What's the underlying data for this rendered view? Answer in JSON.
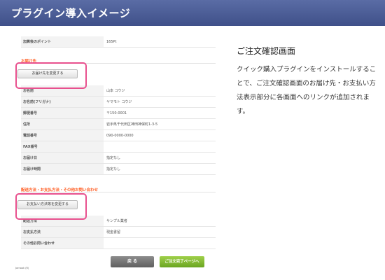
{
  "header": {
    "title": "プラグイン導入イメージ"
  },
  "screenshot": {
    "top_row": {
      "label": "加算後のポイント",
      "value": "165Pt"
    },
    "section_delivery": {
      "title": "お届け先",
      "button": "お届け先を変更する",
      "rows": [
        {
          "label": "お名前",
          "value": "山本 コウジ"
        },
        {
          "label": "お名前(フリガナ)",
          "value": "ヤマモト コウジ"
        },
        {
          "label": "郵便番号",
          "value": "〒150-0001"
        },
        {
          "label": "住所",
          "value": "岩手県千代田区神田神保町1-3-5"
        },
        {
          "label": "電話番号",
          "value": "090-0000-0000"
        },
        {
          "label": "FAX番号",
          "value": ""
        },
        {
          "label": "お届け日",
          "value": "指定なし"
        },
        {
          "label": "お届け時間",
          "value": "指定なし"
        }
      ]
    },
    "section_payment": {
      "title": "配送方法・お支払方法・その他お問い合わせ",
      "button": "お支払い方法等を変更する",
      "rows": [
        {
          "label": "配送方法",
          "value": "サンプル業者"
        },
        {
          "label": "お支払方法",
          "value": "現金書留"
        },
        {
          "label": "その他お問い合わせ",
          "value": ""
        }
      ]
    },
    "buttons": {
      "back": "戻 る",
      "complete": "ご注文完了ページへ"
    },
    "footer_note": "Jarnook (R)"
  },
  "side": {
    "title": "ご注文確認画面",
    "description": "クイック購入プラグインをインストールすることで、ご注文確認画面のお届け先・お支払い方法表示部分に各画面へのリンクが追加されます。"
  },
  "colors": {
    "header_bg": "#4a5b94",
    "highlight": "#e8508e",
    "section_title": "#ff5a1f",
    "complete_button": "#7fbf2e",
    "back_button": "#707070"
  }
}
